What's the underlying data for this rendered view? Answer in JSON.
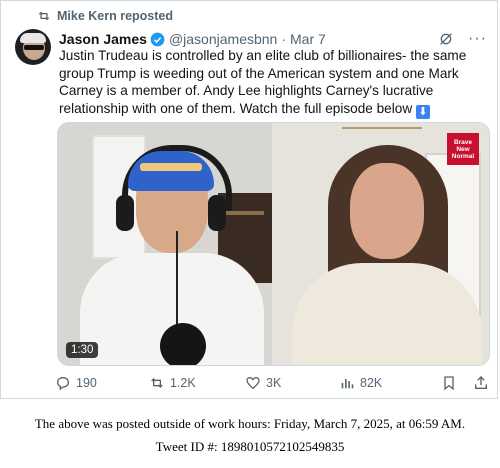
{
  "repost": {
    "label": "Mike Kern reposted",
    "icon": "repost-icon"
  },
  "tweet": {
    "name": "Jason James",
    "handle": "@jasonjamesbnn",
    "separator": "·",
    "date": "Mar 7",
    "text": "Justin Trudeau is controlled by an elite club of billionaires- the same group Trump is weeding out of the American system and one Mark Carney is a member of. Andy Lee highlights Carney's lucrative relationship with one of them. Watch the full episode below",
    "emoji": "⬇",
    "verified_color": "#1d9bf0"
  },
  "media": {
    "duration": "1:30",
    "logo_lines": [
      "Brave",
      "New",
      "Normal"
    ]
  },
  "actions": {
    "replies": "190",
    "reposts": "1.2K",
    "likes": "3K",
    "views": "82K"
  },
  "footer": {
    "line1": "The above was posted outside of work hours: Friday, March 7, 2025, at 06:59 AM.",
    "line2": "Tweet ID #: 1898010572102549835"
  }
}
